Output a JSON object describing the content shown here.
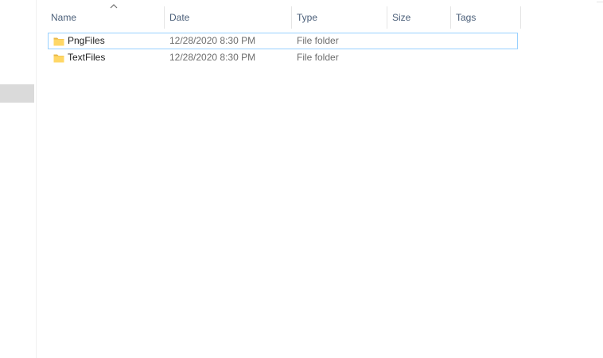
{
  "columns": {
    "name": "Name",
    "date": "Date",
    "type": "Type",
    "size": "Size",
    "tags": "Tags",
    "sorted_by": "name",
    "sort_direction": "ascending"
  },
  "files": [
    {
      "name": "PngFiles",
      "date": "12/28/2020 8:30 PM",
      "type": "File folder",
      "size": "",
      "focused": true
    },
    {
      "name": "TextFiles",
      "date": "12/28/2020 8:30 PM",
      "type": "File folder",
      "size": "",
      "focused": false
    }
  ],
  "icons": {
    "folder": "folder-icon",
    "sort": "sort-ascending-icon"
  },
  "colors": {
    "header_text": "#4c607a",
    "focus_border": "#99d1ff",
    "folder_yellow": "#ffd766",
    "nav_selection": "#dadada"
  }
}
